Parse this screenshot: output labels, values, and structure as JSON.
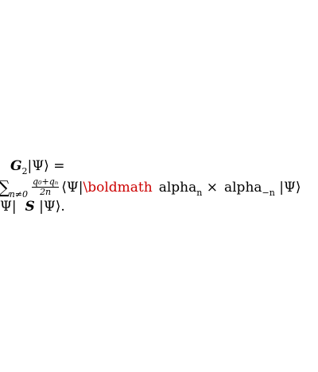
{
  "equation": {
    "line1": {
      "symbol": "G",
      "subscript": "2",
      "rhs": "|Ψ⟩ ="
    },
    "line2": {
      "sum": "∑",
      "sum_subscript": "n≠0",
      "frac_num": "q₀+qₙ",
      "frac_den": "2n",
      "bra": "⟨Ψ|",
      "error_command": "\\boldmath",
      "alpha1": "alpha",
      "alpha1_sub": "n",
      "times": "×",
      "alpha2": "alpha",
      "alpha2_sub": "−n",
      "ket": "|Ψ⟩"
    },
    "line3": {
      "prefix": "Ψ|",
      "symbol": "S",
      "suffix": "|Ψ⟩."
    }
  },
  "colors": {
    "error_text": "#cc0000"
  }
}
